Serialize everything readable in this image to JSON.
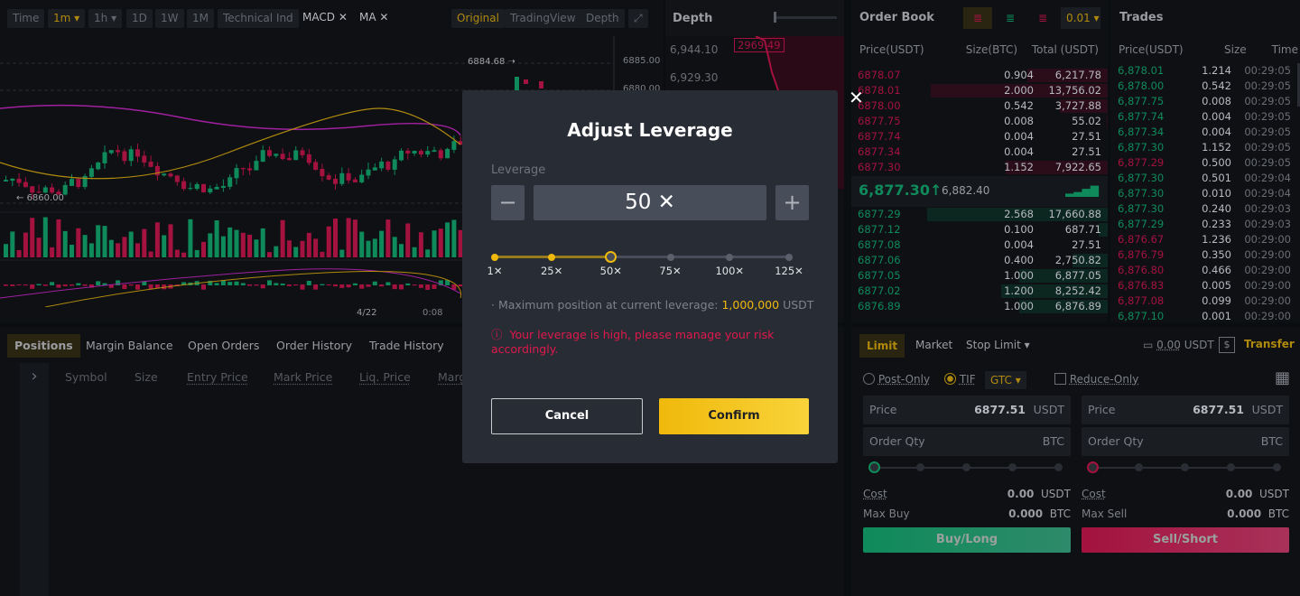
{
  "chart_toolbar": {
    "buttons": [
      "Time",
      "1m",
      "1h",
      "1D",
      "1W",
      "1M",
      "Technical Ind"
    ],
    "indicators": [
      "MACD",
      "MA"
    ],
    "views": [
      "Original",
      "TradingView",
      "Depth"
    ],
    "active_interval": "1m",
    "active_view": "Original"
  },
  "chart": {
    "price_labels": [
      "6885.00",
      "6880.00"
    ],
    "high_marker": "6884.68",
    "low_marker": "6860.00",
    "time_labels": [
      "4/22",
      "0:08"
    ]
  },
  "depth": {
    "title": "Depth",
    "price_labels": [
      "6,944.10",
      "6,929.30"
    ],
    "tooltip": "2969.49"
  },
  "orderbook": {
    "title": "Order Book",
    "precision": "0.01",
    "columns": [
      "Price(USDT)",
      "Size(BTC)",
      "Total (USDT)"
    ],
    "asks": [
      [
        "6878.07",
        "0.904",
        "6,217.78"
      ],
      [
        "6878.01",
        "2.000",
        "13,756.02"
      ],
      [
        "6878.00",
        "0.542",
        "3,727.88"
      ],
      [
        "6877.75",
        "0.008",
        "55.02"
      ],
      [
        "6877.74",
        "0.004",
        "27.51"
      ],
      [
        "6877.34",
        "0.004",
        "27.51"
      ],
      [
        "6877.30",
        "1.152",
        "7,922.65"
      ]
    ],
    "last_price": "6,877.30",
    "last_arrow": "↑",
    "mark_price": "6,882.40",
    "bids": [
      [
        "6877.29",
        "2.568",
        "17,660.88"
      ],
      [
        "6877.12",
        "0.100",
        "687.71"
      ],
      [
        "6877.08",
        "0.004",
        "27.51"
      ],
      [
        "6877.06",
        "0.400",
        "2,750.82"
      ],
      [
        "6877.05",
        "1.000",
        "6,877.05"
      ],
      [
        "6877.02",
        "1.200",
        "8,252.42"
      ],
      [
        "6876.89",
        "1.000",
        "6,876.89"
      ]
    ]
  },
  "trades": {
    "title": "Trades",
    "columns": [
      "Price(USDT)",
      "Size",
      "Time"
    ],
    "rows": [
      [
        "6,878.01",
        "1.214",
        "00:29:05",
        "buy"
      ],
      [
        "6,878.00",
        "0.542",
        "00:29:05",
        "buy"
      ],
      [
        "6,877.75",
        "0.008",
        "00:29:05",
        "buy"
      ],
      [
        "6,877.74",
        "0.004",
        "00:29:05",
        "buy"
      ],
      [
        "6,877.34",
        "0.004",
        "00:29:05",
        "buy"
      ],
      [
        "6,877.30",
        "1.152",
        "00:29:05",
        "buy"
      ],
      [
        "6,877.29",
        "0.500",
        "00:29:05",
        "sell"
      ],
      [
        "6,877.30",
        "0.501",
        "00:29:04",
        "buy"
      ],
      [
        "6,877.30",
        "0.010",
        "00:29:04",
        "buy"
      ],
      [
        "6,877.30",
        "0.240",
        "00:29:03",
        "buy"
      ],
      [
        "6,877.29",
        "0.233",
        "00:29:03",
        "buy"
      ],
      [
        "6,876.67",
        "1.236",
        "00:29:00",
        "sell"
      ],
      [
        "6,876.79",
        "0.350",
        "00:29:00",
        "sell"
      ],
      [
        "6,876.80",
        "0.466",
        "00:29:00",
        "sell"
      ],
      [
        "6,876.83",
        "0.005",
        "00:29:00",
        "sell"
      ],
      [
        "6,877.08",
        "0.099",
        "00:29:00",
        "sell"
      ],
      [
        "6,877.10",
        "0.001",
        "00:29:00",
        "buy"
      ]
    ]
  },
  "bottom": {
    "tabs": [
      "Positions",
      "Margin Balance",
      "Open Orders",
      "Order History",
      "Trade History"
    ],
    "columns": [
      "Symbol",
      "Size",
      "Entry Price",
      "Mark Price",
      "Liq. Price",
      "Marg"
    ]
  },
  "order_form": {
    "types": [
      "Limit",
      "Market",
      "Stop Limit"
    ],
    "balance": "0.00",
    "balance_unit": "USDT",
    "transfer": "Transfer",
    "post_only": "Post-Only",
    "tif": "TIF",
    "tif_value": "GTC",
    "reduce_only": "Reduce-Only",
    "buy": {
      "price_label": "Price",
      "price": "6877.51",
      "price_unit": "USDT",
      "qty_label": "Order Qty",
      "qty_unit": "BTC",
      "cost_label": "Cost",
      "cost": "0.00",
      "cost_unit": "USDT",
      "max_label": "Max Buy",
      "max": "0.000",
      "max_unit": "BTC",
      "button": "Buy/Long"
    },
    "sell": {
      "price_label": "Price",
      "price": "6877.51",
      "price_unit": "USDT",
      "qty_label": "Order Qty",
      "qty_unit": "BTC",
      "cost_label": "Cost",
      "cost": "0.00",
      "cost_unit": "USDT",
      "max_label": "Max Sell",
      "max": "0.000",
      "max_unit": "BTC",
      "button": "Sell/Short"
    }
  },
  "modal": {
    "title": "Adjust Leverage",
    "leverage_label": "Leverage",
    "value": "50 ✕",
    "current_leverage": 50,
    "marks": [
      "1✕",
      "25✕",
      "50✕",
      "75✕",
      "100✕",
      "125✕"
    ],
    "max_text": "· Maximum position at current leverage:",
    "max_value": "1,000,000",
    "max_unit": "USDT",
    "warning": "Your leverage is high, please manage your risk accordingly.",
    "cancel": "Cancel",
    "confirm": "Confirm"
  },
  "colors": {
    "accent": "#f0b90b",
    "buy": "#0f8a5b",
    "sell": "#a4123f"
  }
}
